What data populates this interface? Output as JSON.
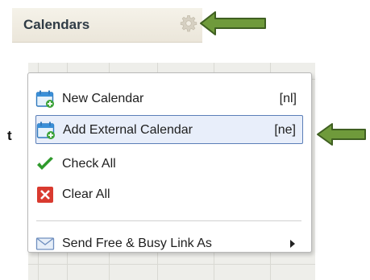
{
  "header": {
    "title": "Calendars",
    "gear_icon": "gear-icon"
  },
  "peek_text": "t",
  "menu": {
    "items": [
      {
        "label": "New Calendar",
        "shortcut": "[nl]",
        "icon": "new-calendar-icon"
      },
      {
        "label": "Add External Calendar",
        "shortcut": "[ne]",
        "icon": "add-external-calendar-icon",
        "selected": true
      },
      {
        "label": "Check All",
        "icon": "checkmark-icon"
      },
      {
        "label": "Clear All",
        "icon": "red-x-icon"
      },
      {
        "label": "Send Free & Busy Link As",
        "icon": "envelope-icon",
        "has_submenu": true
      }
    ]
  },
  "colors": {
    "arrow": "#6f9a3b",
    "arrow_outline": "#3f5f21",
    "selection_border": "#5b7fb8",
    "selection_fill": "#e8eefa"
  }
}
